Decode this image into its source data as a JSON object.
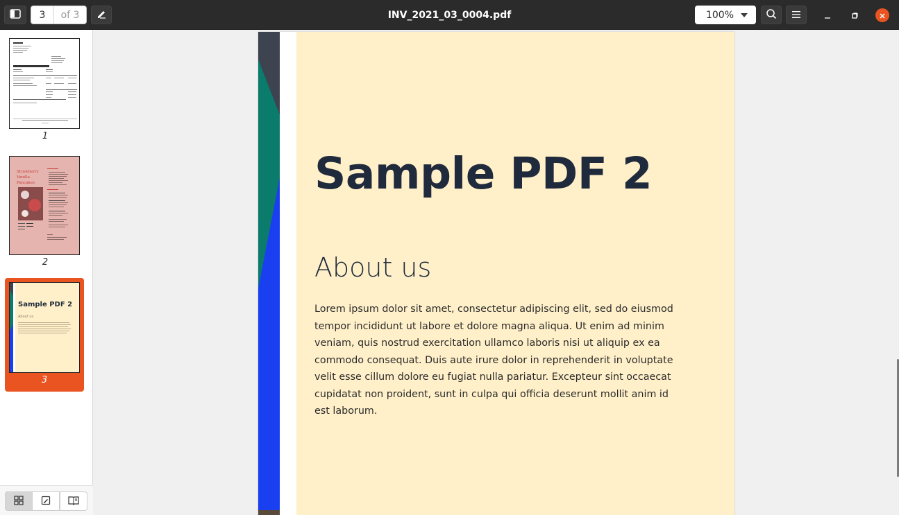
{
  "header": {
    "title": "INV_2021_03_0004.pdf",
    "current_page": "3",
    "page_of": "of 3",
    "zoom": "100%"
  },
  "sidebar": {
    "thumbnails": [
      {
        "label": "1"
      },
      {
        "label": "2"
      },
      {
        "label": "3"
      }
    ],
    "thumb2_text": "Strawberry Vanilla Pancakes",
    "thumb3_title": "Sample PDF 2",
    "thumb3_subtitle": "About us"
  },
  "document": {
    "heading": "Sample PDF 2",
    "subheading": "About us",
    "paragraph": "Lorem ipsum dolor sit amet, consectetur adipiscing elit, sed do eiusmod tempor incididunt ut labore et dolore magna aliqua. Ut enim ad minim veniam, quis nostrud exercitation ullamco laboris nisi ut aliquip ex ea commodo consequat. Duis aute irure dolor in reprehenderit in voluptate velit esse cillum dolore eu fugiat nulla pariatur. Excepteur sint occaecat cupidatat non proident, sunt in culpa qui officia deserunt mollit anim id est laborum."
  },
  "colors": {
    "header_bg": "#2b2b2b",
    "accent": "#e95420",
    "page_bg": "#fff0c9",
    "heading": "#1f2a3c",
    "strip_dark": "#3d4450",
    "strip_teal": "#0b7c6b",
    "strip_blue": "#1a3ff0"
  },
  "icons": {
    "sidebar_toggle": "sidebar-toggle-icon",
    "annotate": "pencil-icon",
    "search": "search-icon",
    "menu": "hamburger-menu-icon",
    "minimize": "minimize-icon",
    "maximize": "maximize-icon",
    "close": "close-icon",
    "thumbnails": "grid-icon",
    "annotations": "annotations-icon",
    "bookmarks": "book-icon"
  }
}
